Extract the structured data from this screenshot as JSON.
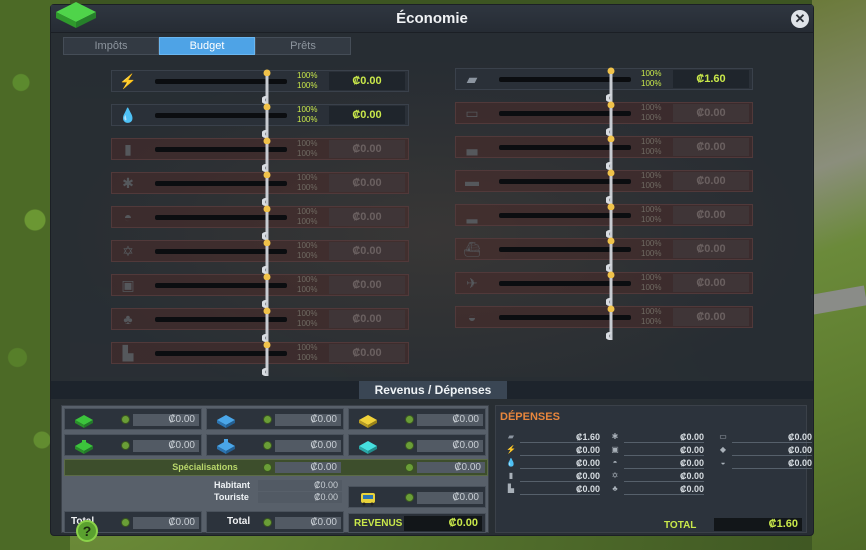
{
  "window": {
    "title": "Économie"
  },
  "tabs": [
    {
      "label": "Impôts",
      "active": false
    },
    {
      "label": "Budget",
      "active": true
    },
    {
      "label": "Prêts",
      "active": false
    }
  ],
  "budget": {
    "left": [
      {
        "icon": "lightning-icon",
        "pct_day": "100%",
        "pct_night": "100%",
        "value": "₡0.00",
        "dim": false
      },
      {
        "icon": "water-drop-icon",
        "pct_day": "100%",
        "pct_night": "100%",
        "value": "₡0.00",
        "dim": false
      },
      {
        "icon": "garbage-icon",
        "pct_day": "100%",
        "pct_night": "100%",
        "value": "₡0.00",
        "dim": true
      },
      {
        "icon": "health-icon",
        "pct_day": "100%",
        "pct_night": "100%",
        "value": "₡0.00",
        "dim": true
      },
      {
        "icon": "fire-icon",
        "pct_day": "100%",
        "pct_night": "100%",
        "value": "₡0.00",
        "dim": true
      },
      {
        "icon": "police-icon",
        "pct_day": "100%",
        "pct_night": "100%",
        "value": "₡0.00",
        "dim": true
      },
      {
        "icon": "education-icon",
        "pct_day": "100%",
        "pct_night": "100%",
        "value": "₡0.00",
        "dim": true
      },
      {
        "icon": "park-icon",
        "pct_day": "100%",
        "pct_night": "100%",
        "value": "₡0.00",
        "dim": true
      },
      {
        "icon": "monument-icon",
        "pct_day": "100%",
        "pct_night": "100%",
        "value": "₡0.00",
        "dim": true
      }
    ],
    "right": [
      {
        "icon": "road-icon",
        "pct_day": "100%",
        "pct_night": "100%",
        "value": "₡1.60",
        "dim": false
      },
      {
        "icon": "bus-icon",
        "pct_day": "100%",
        "pct_night": "100%",
        "value": "₡0.00",
        "dim": true
      },
      {
        "icon": "metro-icon",
        "pct_day": "100%",
        "pct_night": "100%",
        "value": "₡0.00",
        "dim": true
      },
      {
        "icon": "train-icon",
        "pct_day": "100%",
        "pct_night": "100%",
        "value": "₡0.00",
        "dim": true
      },
      {
        "icon": "tram-icon",
        "pct_day": "100%",
        "pct_night": "100%",
        "value": "₡0.00",
        "dim": true
      },
      {
        "icon": "ship-icon",
        "pct_day": "100%",
        "pct_night": "100%",
        "value": "₡0.00",
        "dim": true
      },
      {
        "icon": "plane-icon",
        "pct_day": "100%",
        "pct_night": "100%",
        "value": "₡0.00",
        "dim": true
      },
      {
        "icon": "taxi-icon",
        "pct_day": "100%",
        "pct_night": "100%",
        "value": "₡0.00",
        "dim": true
      }
    ]
  },
  "section": {
    "title": "Revenus / Dépenses"
  },
  "revenus": {
    "zones": [
      {
        "icon": "residential-low-icon",
        "value": "₡0.00"
      },
      {
        "icon": "commercial-low-icon",
        "value": "₡0.00"
      },
      {
        "icon": "industrial-icon",
        "value": "₡0.00"
      },
      {
        "icon": "residential-high-icon",
        "value": "₡0.00"
      },
      {
        "icon": "commercial-high-icon",
        "value": "₡0.00"
      },
      {
        "icon": "office-icon",
        "value": "₡0.00"
      }
    ],
    "specialisations_label": "Spécialisations",
    "specialisations_value_1": "₡0.00",
    "specialisations_value_2": "₡0.00",
    "habitant_label": "Habitant",
    "habitant_value": "₡0.00",
    "touriste_label": "Touriste",
    "touriste_value": "₡0.00",
    "transport_value": "₡0.00",
    "total_label": "Total",
    "total_zones_value": "₡0.00",
    "total_citizens_label": "Total",
    "total_citizens_value": "₡0.00",
    "revenus_label": "REVENUS",
    "revenus_value": "₡0.00"
  },
  "depenses": {
    "title": "DÉPENSES",
    "col1": [
      {
        "icon": "road-icon",
        "value": "₡1.60"
      },
      {
        "icon": "lightning-icon",
        "value": "₡0.00"
      },
      {
        "icon": "water-drop-icon",
        "value": "₡0.00"
      },
      {
        "icon": "garbage-icon",
        "value": "₡0.00"
      },
      {
        "icon": "monument-icon",
        "value": "₡0.00"
      }
    ],
    "col2": [
      {
        "icon": "health-icon",
        "value": "₡0.00"
      },
      {
        "icon": "education-icon",
        "value": "₡0.00"
      },
      {
        "icon": "fire-icon",
        "value": "₡0.00"
      },
      {
        "icon": "police-icon",
        "value": "₡0.00"
      },
      {
        "icon": "park-icon",
        "value": "₡0.00"
      }
    ],
    "col3": [
      {
        "icon": "bus-icon",
        "value": "₡0.00"
      },
      {
        "icon": "specialisation-icon",
        "value": "₡0.00"
      },
      {
        "icon": "taxi-icon",
        "value": "₡0.00"
      }
    ],
    "total_label": "TOTAL",
    "total_value": "₡1.60"
  },
  "help": {
    "label": "?"
  },
  "close": {
    "label": "✕"
  },
  "colors": {
    "accent": "#4ea3e6",
    "money": "#c9e84a",
    "expense": "#e8863c"
  }
}
